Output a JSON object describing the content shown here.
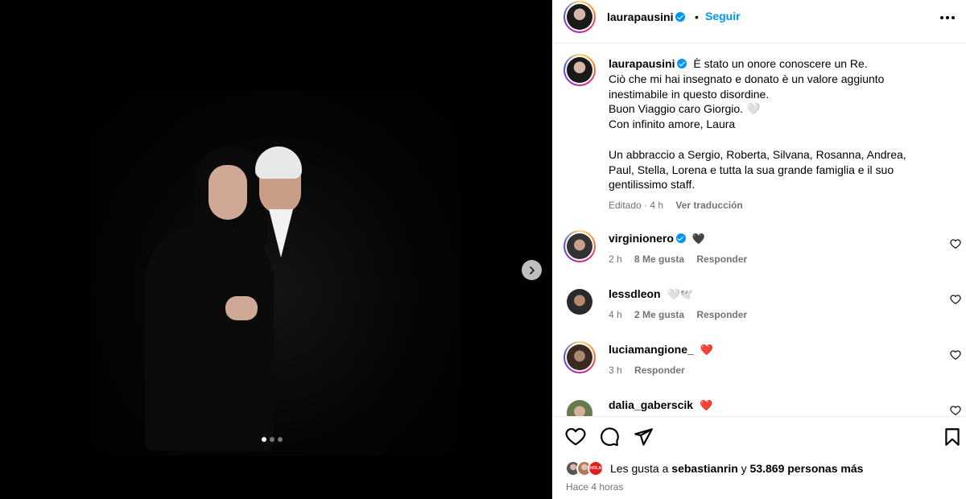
{
  "post": {
    "username": "laurapausini",
    "follow_label": "Seguir",
    "bullet": "•",
    "caption_lines": [
      "È stato un onore conoscere un Re.",
      "Ciò che mi hai insegnato e donato è un valore aggiunto",
      "inestimabile in questo disordine.",
      "Buon Viaggio caro Giorgio. 🤍",
      "Con infinito amore, Laura",
      "",
      "Un abbraccio a Sergio, Roberta, Silvana, Rosanna, Andrea,",
      "Paul, Stella, Lorena e tutta la sua grande famiglia e il suo",
      "gentilissimo staff."
    ],
    "edited_meta": "Editado · 4 h",
    "translate_label": "Ver traducción"
  },
  "carousel": {
    "slide_count": 3,
    "active_slide": 0
  },
  "comments": [
    {
      "username": "virginionero",
      "verified": true,
      "text": "🖤",
      "time": "2 h",
      "likes": "8 Me gusta",
      "reply": "Responder"
    },
    {
      "username": "lessdleon",
      "verified": false,
      "text": "🤍🕊️",
      "time": "4 h",
      "likes": "2 Me gusta",
      "reply": "Responder"
    },
    {
      "username": "luciamangione_",
      "verified": false,
      "text": "❤️",
      "time": "3 h",
      "likes": "",
      "reply": "Responder"
    },
    {
      "username": "dalia_gaberscik",
      "verified": false,
      "text": "❤️",
      "time": "",
      "likes": "",
      "reply": ""
    }
  ],
  "footer": {
    "likes_prefix": "Les gusta a",
    "likes_user": "sebastianrin",
    "likes_connector": "y",
    "likes_count": "53.869 personas más",
    "mini_avatar_badge": "¡HOLA!",
    "time_ago": "Hace 4 horas"
  },
  "icons": [
    "heart-icon",
    "comment-icon",
    "share-icon",
    "bookmark-icon",
    "more-icon",
    "chevron-right-icon",
    "verified-icon"
  ],
  "colors": {
    "accent": "#0095f6",
    "muted": "#737373",
    "heart_red": "#ed4956"
  }
}
